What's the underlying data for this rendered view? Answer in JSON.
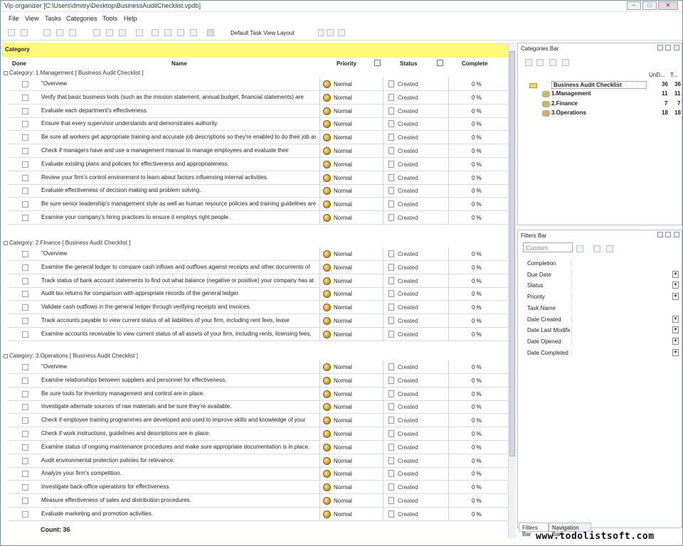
{
  "window": {
    "title": "Vip organizer [C:\\Users\\dmitry\\Desktop\\BusinessAuditChecklist.vpdb]"
  },
  "menu": [
    "File",
    "View",
    "Tasks",
    "Categories",
    "Tools",
    "Help"
  ],
  "toolbar": {
    "layout_label": "Default Task View Layout"
  },
  "grid": {
    "category_band": "Category",
    "columns": {
      "done": "Done",
      "name": "Name",
      "priority": "Priority",
      "status": "Status",
      "complete": "Complete"
    },
    "count_label": "Count: 36"
  },
  "groups": [
    {
      "label": "Category: 1.Management    [ Business Audit Checklist ]",
      "rows": [
        {
          "name": "\"Overview",
          "priority": "Normal",
          "status": "Created",
          "complete": "0 %"
        },
        {
          "name": "Verify that basic business tools (such as the mission statement, annual budget, financial statements) are",
          "priority": "Normal",
          "status": "Created",
          "complete": "0 %"
        },
        {
          "name": "Evaluate each department's effectiveness.",
          "priority": "Normal",
          "status": "Created",
          "complete": "0 %"
        },
        {
          "name": "Ensure that every supervisor understands and demonstrates authority.",
          "priority": "Normal",
          "status": "Created",
          "complete": "0 %"
        },
        {
          "name": "Be sure all workers get appropriate training and accurate job descriptions so they're enabled to do their job as",
          "priority": "Normal",
          "status": "Created",
          "complete": "0 %"
        },
        {
          "name": "Check if managers have and use a management manual to manage employees and evaluate their",
          "priority": "Normal",
          "status": "Created",
          "complete": "0 %"
        },
        {
          "name": "Evaluate existing plans and policies for effectiveness and appropriateness.",
          "priority": "Normal",
          "status": "Created",
          "complete": "0 %"
        },
        {
          "name": "Review your firm's control environment to learn about factors influencing internal activities.",
          "priority": "Normal",
          "status": "Created",
          "complete": "0 %"
        },
        {
          "name": "Evaluate effectiveness of decision making and problem solving.",
          "priority": "Normal",
          "status": "Created",
          "complete": "0 %"
        },
        {
          "name": "Be sure senior leadership's management style as well as human resource policies and training guidelines are",
          "priority": "Normal",
          "status": "Created",
          "complete": "0 %"
        },
        {
          "name": "Examine your company's hiring practices to ensure it employs right people.",
          "priority": "Normal",
          "status": "Created",
          "complete": "0 %"
        }
      ]
    },
    {
      "label": "Category: 2.Finance    [ Business Audit Checklist ]",
      "rows": [
        {
          "name": "\"Overview",
          "priority": "Normal",
          "status": "Created",
          "complete": "0 %"
        },
        {
          "name": "Examine the general ledger to compare cash inflows and outflows against receipts and other documents of",
          "priority": "Normal",
          "status": "Created",
          "complete": "0 %"
        },
        {
          "name": "Track status of bank account statements to find out what balance (negative or positive) your company has at",
          "priority": "Normal",
          "status": "Created",
          "complete": "0 %"
        },
        {
          "name": "Audit tax returns for comparison with appropriate records of the general ledger.",
          "priority": "Normal",
          "status": "Created",
          "complete": "0 %"
        },
        {
          "name": "Validate cash outflows in the general ledger through verifying receipts and invoices.",
          "priority": "Normal",
          "status": "Created",
          "complete": "0 %"
        },
        {
          "name": "Track accounts payable to view current status of all liabilities of your firm, including rent fees, lease",
          "priority": "Normal",
          "status": "Created",
          "complete": "0 %"
        },
        {
          "name": "Examine accounts receivable to view current status of all assets of your firm, including rents, licensing fees,",
          "priority": "Normal",
          "status": "Created",
          "complete": "0 %"
        }
      ]
    },
    {
      "label": "Category: 3.Operations    [ Business Audit Checklist ]",
      "rows": [
        {
          "name": "\"Overview",
          "priority": "Normal",
          "status": "Created",
          "complete": "0 %"
        },
        {
          "name": "Examine relationships between suppliers and personnel for effectiveness.",
          "priority": "Normal",
          "status": "Created",
          "complete": "0 %"
        },
        {
          "name": "Be sure tools for inventory management and control are in place.",
          "priority": "Normal",
          "status": "Created",
          "complete": "0 %"
        },
        {
          "name": "Investigate alternate sources of raw materials and be sure they're available.",
          "priority": "Normal",
          "status": "Created",
          "complete": "0 %"
        },
        {
          "name": "Check if employee training programmes are developed and used to improve skills and knowledge of your",
          "priority": "Normal",
          "status": "Created",
          "complete": "0 %"
        },
        {
          "name": "Check if work instructions, guidelines and descriptions are in place.",
          "priority": "Normal",
          "status": "Created",
          "complete": "0 %"
        },
        {
          "name": "Examine status of ongoing maintenance procedures and make sure appropriate documentation is in place.",
          "priority": "Normal",
          "status": "Created",
          "complete": "0 %"
        },
        {
          "name": "Audit environmental protection policies for relevance.",
          "priority": "Normal",
          "status": "Created",
          "complete": "0 %"
        },
        {
          "name": "Analyze your firm's competition.",
          "priority": "Normal",
          "status": "Created",
          "complete": "0 %"
        },
        {
          "name": "Investigate back-office operations for effectiveness.",
          "priority": "Normal",
          "status": "Created",
          "complete": "0 %"
        },
        {
          "name": "Measure effectiveness of sales and distribution procedures.",
          "priority": "Normal",
          "status": "Created",
          "complete": "0 %"
        },
        {
          "name": "Evaluate marketing and promotion activities.",
          "priority": "Normal",
          "status": "Created",
          "complete": "0 %"
        }
      ]
    }
  ],
  "categories_bar": {
    "title": "Categories Bar",
    "col_undone": "UnD...",
    "col_total": "T...",
    "items": [
      {
        "label": "Business Audit Checklist",
        "undone": "36",
        "total": "36"
      },
      {
        "label": "1.Management",
        "undone": "11",
        "total": "11"
      },
      {
        "label": "2.Finance",
        "undone": "7",
        "total": "7"
      },
      {
        "label": "3.Operations",
        "undone": "18",
        "total": "18"
      }
    ]
  },
  "filters_bar": {
    "title": "Filters Bar",
    "preset": "Custom",
    "fields": [
      "Completion",
      "Due Date",
      "Status",
      "Priority",
      "Task Name",
      "Date Created",
      "Date Last Modified",
      "Date Opened",
      "Date Completed"
    ],
    "tabs": [
      "Filters Bar",
      "Navigation Bar"
    ]
  },
  "watermark": "www.todolistsoft.com"
}
